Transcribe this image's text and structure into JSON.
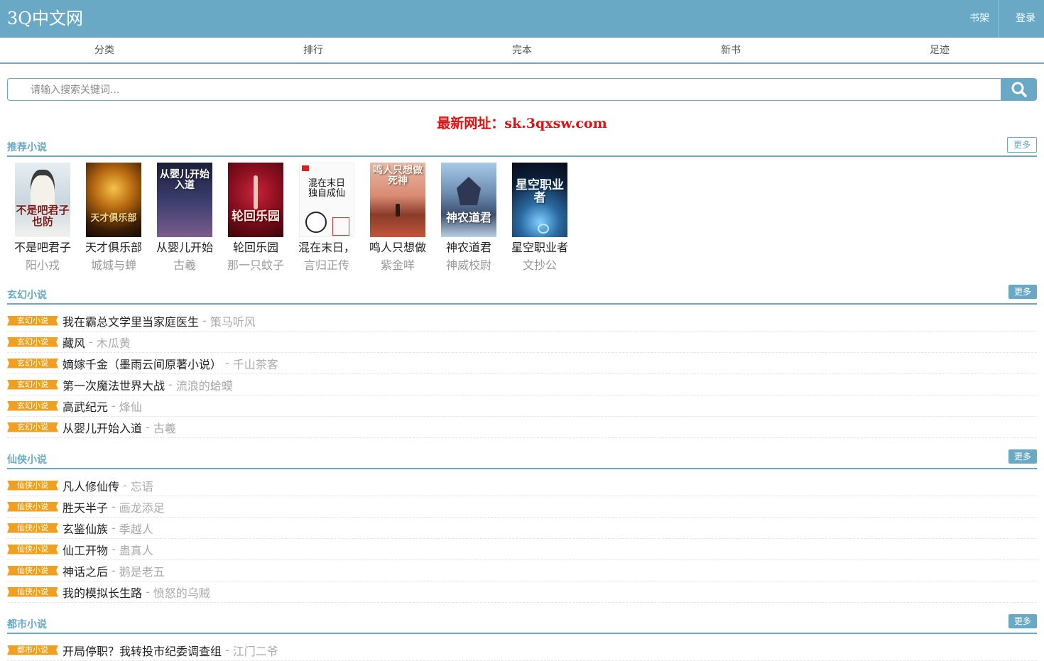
{
  "site": {
    "logo": "3Q中文网",
    "shelf": "书架",
    "login": "登录"
  },
  "nav": [
    "分类",
    "排行",
    "完本",
    "新书",
    "足迹"
  ],
  "search": {
    "placeholder": "请输入搜索关键词..."
  },
  "notice": "最新网址：sk.3qxsw.com",
  "colors": {
    "accent": "#6aa9c6",
    "tag": "#f0a020",
    "notice": "#e01010"
  },
  "sections": {
    "recommend": {
      "title": "推荐小说",
      "more": "更多"
    },
    "xuanhuan": {
      "title": "玄幻小说",
      "more": "更多",
      "tag": "玄幻小说"
    },
    "xianxia": {
      "title": "仙侠小说",
      "more": "更多",
      "tag": "仙侠小说"
    },
    "dushi": {
      "title": "都市小说",
      "more": "更多",
      "tag": "都市小说"
    }
  },
  "recommend_books": [
    {
      "title": "不是吧君子",
      "author": "阳小戎",
      "cover_text": "不是吧君子也防"
    },
    {
      "title": "天才俱乐部",
      "author": "城城与蝉",
      "cover_text": "天才俱乐部"
    },
    {
      "title": "从婴儿开始",
      "author": "古羲",
      "cover_text": "从婴儿开始入道"
    },
    {
      "title": "轮回乐园",
      "author": "那一只蚊子",
      "cover_text": "轮回乐园"
    },
    {
      "title": "混在末日，",
      "author": "言归正传",
      "cover_text": "混在末日独自成仙"
    },
    {
      "title": "鸣人只想做",
      "author": "紫金咩",
      "cover_text": "鸣人只想做死神"
    },
    {
      "title": "神农道君",
      "author": "神威校尉",
      "cover_text": "神农道君"
    },
    {
      "title": "星空职业者",
      "author": "文抄公",
      "cover_text": "星空职业者"
    }
  ],
  "xuanhuan_list": [
    {
      "title": "我在霸总文学里当家庭医生",
      "author": "策马听风"
    },
    {
      "title": "藏风",
      "author": "木瓜黄"
    },
    {
      "title": "嫡嫁千金（墨雨云间原著小说）",
      "author": "千山茶客"
    },
    {
      "title": "第一次魔法世界大战",
      "author": "流浪的蛤蟆"
    },
    {
      "title": "高武纪元",
      "author": "烽仙"
    },
    {
      "title": "从婴儿开始入道",
      "author": "古羲"
    }
  ],
  "xianxia_list": [
    {
      "title": "凡人修仙传",
      "author": "忘语"
    },
    {
      "title": "胜天半子",
      "author": "画龙添足"
    },
    {
      "title": "玄鉴仙族",
      "author": "季越人"
    },
    {
      "title": "仙工开物",
      "author": "蛊真人"
    },
    {
      "title": "神话之后",
      "author": "鹅是老五"
    },
    {
      "title": "我的模拟长生路",
      "author": "愤怒的乌贼"
    }
  ],
  "dushi_list": [
    {
      "title": "开局停职？我转投市纪委调查组",
      "author": "江门二爷"
    }
  ],
  "list_separator": "-"
}
